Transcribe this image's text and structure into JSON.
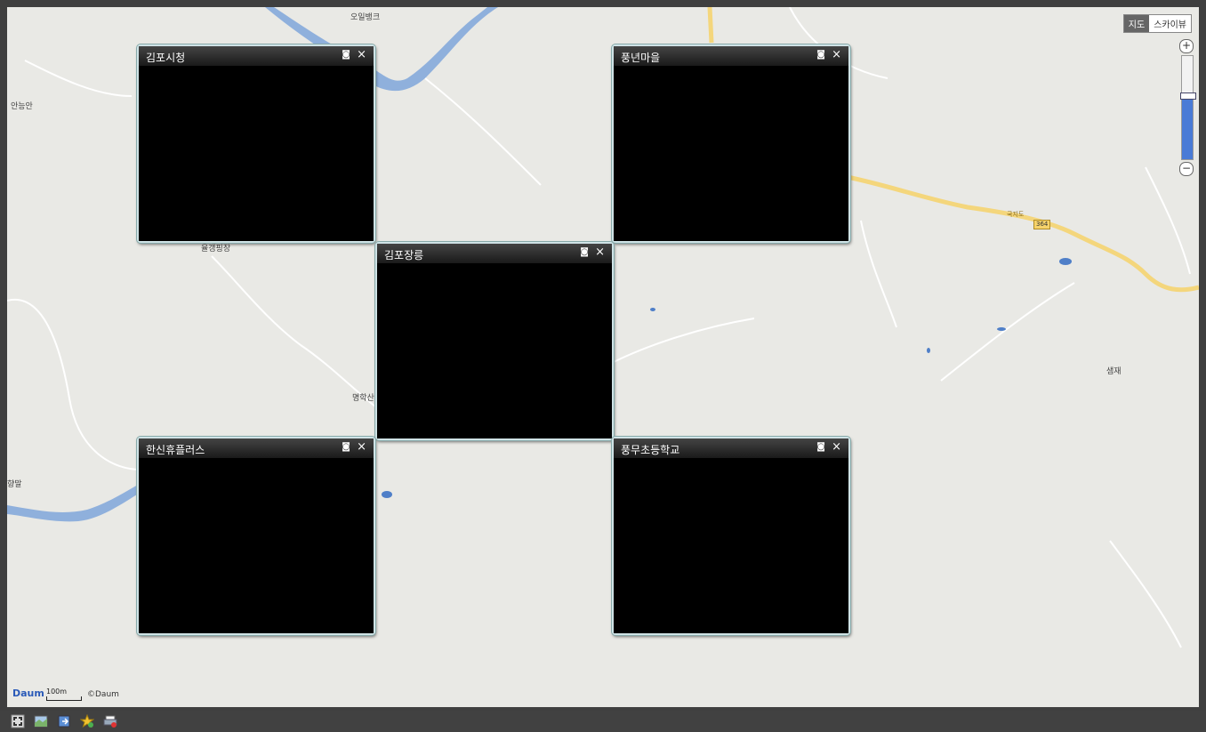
{
  "map": {
    "labels": {
      "ohil_bank": "오일뱅크",
      "annungan": "안능안",
      "yulgaeng": "율갱핑장",
      "myeonghak": "명학산",
      "hyangmal": "향말",
      "saemjae": "샘재",
      "road_number": "364",
      "road_name": "국지도"
    },
    "maptype": {
      "map": "지도",
      "skyview": "스카이뷰"
    },
    "zoom": {
      "plus": "+",
      "minus": "−",
      "level_fraction": 0.62
    },
    "logo": "Daum",
    "scale": "100m",
    "copyright": "©Daum"
  },
  "cctvs": [
    {
      "title": "김포시청",
      "cam_icon": "◙",
      "close": "×"
    },
    {
      "title": "풍년마을",
      "cam_icon": "◙",
      "close": "×"
    },
    {
      "title": "김포장릉",
      "cam_icon": "◙",
      "close": "×"
    },
    {
      "title": "한신휴플러스",
      "cam_icon": "◙",
      "close": "×"
    },
    {
      "title": "풍무초등학교",
      "cam_icon": "◙",
      "close": "×"
    }
  ],
  "toolbar": {
    "icons": [
      "fullscreen-icon",
      "map-icon",
      "export-icon",
      "favorite-add-icon",
      "print-icon"
    ]
  },
  "colors": {
    "river": "#8fb0dc",
    "major_road": "#f4d67c",
    "water": "#4f7fc8"
  }
}
